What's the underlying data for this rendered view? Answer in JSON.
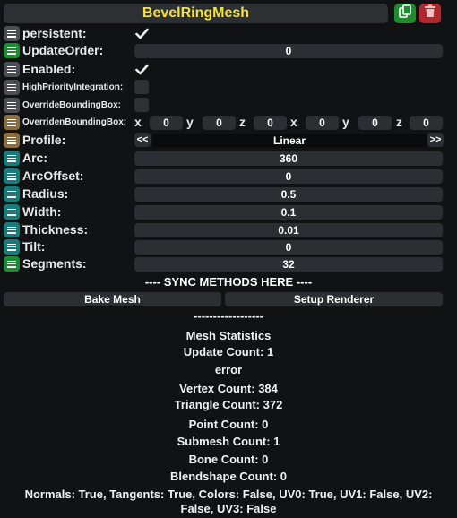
{
  "title": "BevelRingMesh",
  "icons": {
    "duplicate": "duplicate-icon",
    "delete": "trash-icon",
    "handle": "drag-handle-icon",
    "check": "checkmark-icon"
  },
  "colors": {
    "title": "#f5e23a",
    "duplicate": "#1f8a2e",
    "delete": "#b0282d"
  },
  "fields": {
    "persistent": {
      "label": "persistent:",
      "checked": true
    },
    "update_order": {
      "label": "UpdateOrder:",
      "value": "0"
    },
    "enabled": {
      "label": "Enabled:",
      "checked": true
    },
    "high_priority": {
      "label": "HighPriorityIntegration:",
      "checked": false
    },
    "override_bbox": {
      "label": "OverrideBoundingBox:",
      "checked": false
    },
    "overriden_bbox": {
      "label": "OverridenBoundingBox:",
      "x1_label": "x",
      "x1": "0",
      "y1_label": "y",
      "y1": "0",
      "z1_label": "z",
      "z1": "0",
      "x2_label": "x",
      "x2": "0",
      "y2_label": "y",
      "y2": "0",
      "z2_label": "z",
      "z2": "0"
    },
    "profile": {
      "label": "Profile:",
      "value": "Linear",
      "prev": "<<",
      "next": ">>"
    },
    "arc": {
      "label": "Arc:",
      "value": "360"
    },
    "arc_offset": {
      "label": "ArcOffset:",
      "value": "0"
    },
    "radius": {
      "label": "Radius:",
      "value": "0.5"
    },
    "width": {
      "label": "Width:",
      "value": "0.1"
    },
    "thickness": {
      "label": "Thickness:",
      "value": "0.01"
    },
    "tilt": {
      "label": "Tilt:",
      "value": "0"
    },
    "segments": {
      "label": "Segments:",
      "value": "32"
    }
  },
  "sync_header": "---- SYNC METHODS HERE ----",
  "buttons": {
    "bake_mesh": "Bake Mesh",
    "setup_renderer": "Setup Renderer"
  },
  "divider": "------------------",
  "stats": {
    "title": "Mesh Statistics",
    "update_count": "Update Count: 1",
    "error": "error",
    "vertex_count": "Vertex Count: 384",
    "triangle_count": "Triangle Count: 372",
    "point_count": "Point Count: 0",
    "submesh_count": "Submesh Count: 1",
    "bone_count": "Bone Count: 0",
    "blendshape_count": "Blendshape Count: 0",
    "channels_line1": "Normals: True, Tangents: True, Colors: False, UV0: True, UV1: False, UV2:",
    "channels_line2": "False, UV3: False"
  }
}
